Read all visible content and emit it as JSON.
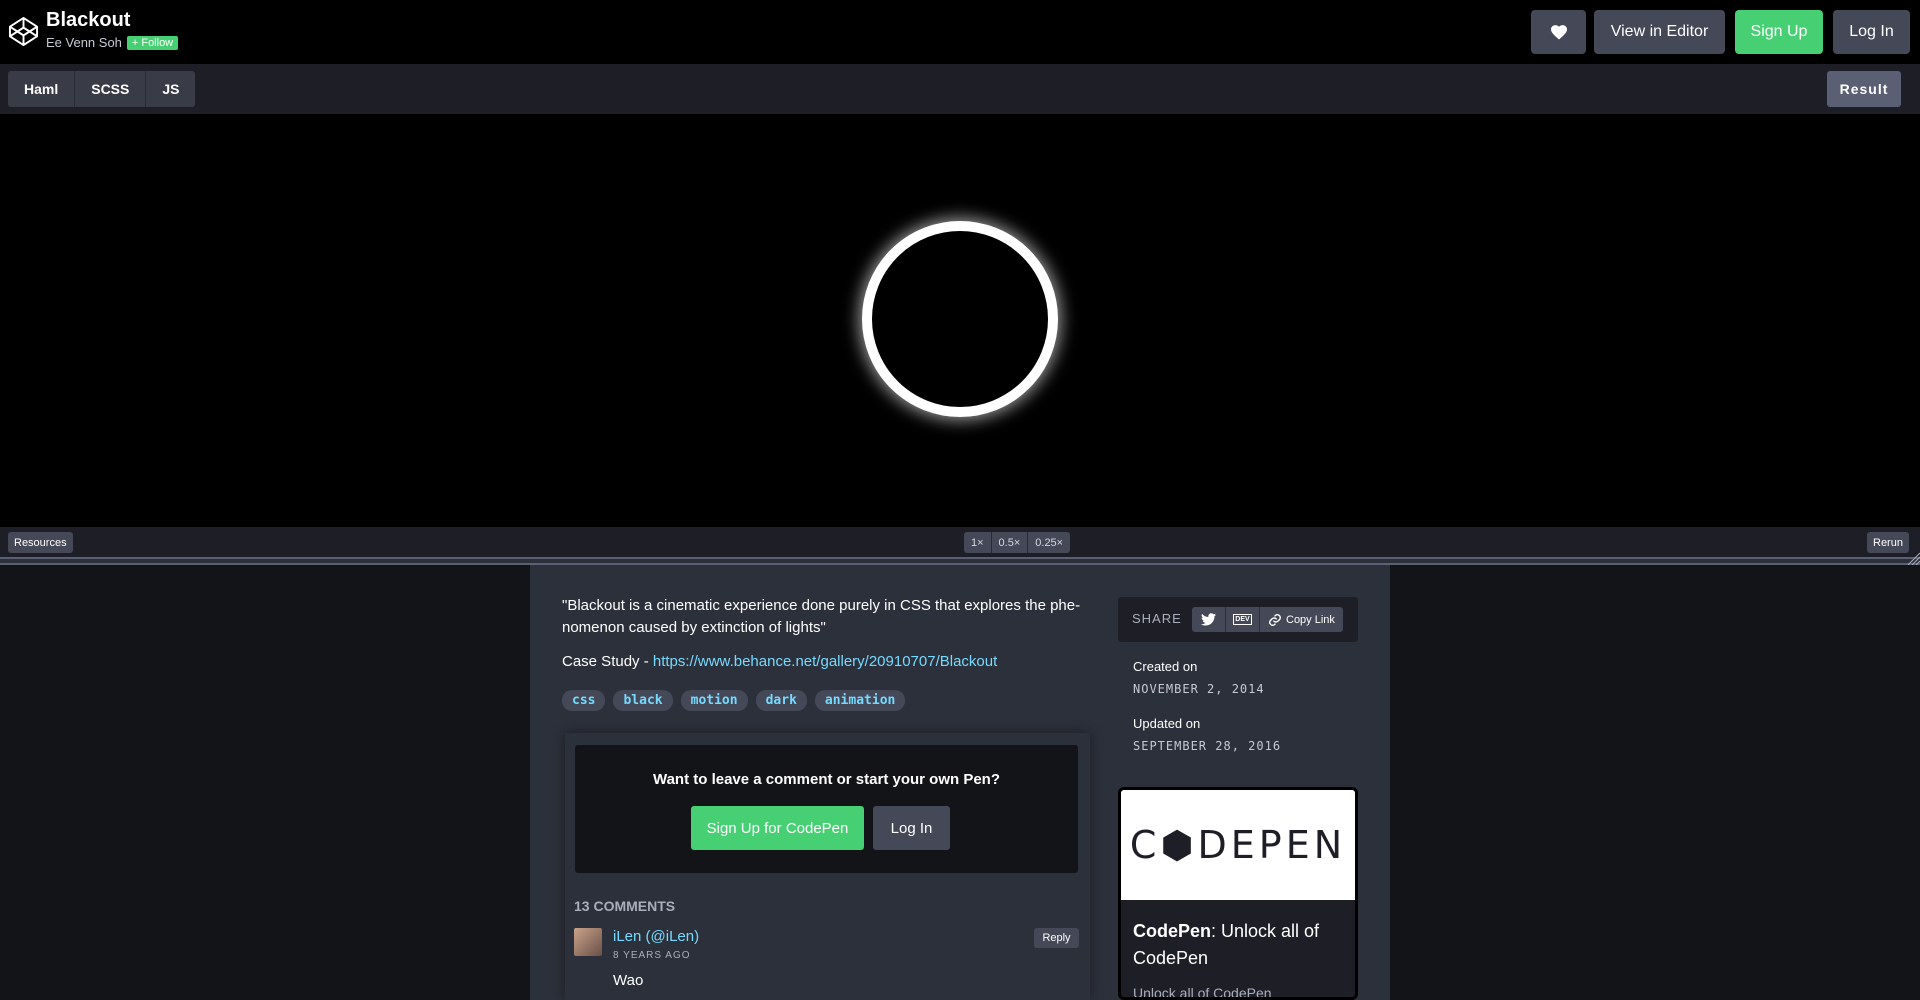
{
  "header": {
    "pen_title": "Blackout",
    "author": "Ee Venn Soh",
    "follow_label": "Follow",
    "view_in_editor": "View in Editor",
    "sign_up": "Sign Up",
    "log_in": "Log In"
  },
  "tabs": [
    "Haml",
    "SCSS",
    "JS"
  ],
  "result_tab": "Result",
  "preview_bar": {
    "resources": "Resources",
    "zoom_options": [
      "1×",
      "0.5×",
      "0.25×"
    ],
    "rerun": "Rerun"
  },
  "details": {
    "description": "\"Blackout is a cinematic experience done purely in CSS that explores the phe-nomenon caused by extinction of lights\"",
    "case_prefix": "Case Study - ",
    "case_link": "https://www.behance.net/gallery/20910707/Blackout",
    "tags": [
      "css",
      "black",
      "motion",
      "dark",
      "animation"
    ]
  },
  "comments": {
    "cta_text": "Want to leave a comment or start your own Pen?",
    "cta_signup": "Sign Up for CodePen",
    "cta_login": "Log In",
    "count_label": "13 COMMENTS",
    "first": {
      "name": "iLen (@iLen)",
      "time": "8 YEARS AGO",
      "reply": "Reply",
      "body": "Wao"
    }
  },
  "sidebar": {
    "share_label": "SHARE",
    "dev_label": "DEV",
    "copy_link": "Copy Link",
    "created_label": "Created on",
    "created_date": "NOVEMBER 2, 2014",
    "updated_label": "Updated on",
    "updated_date": "SEPTEMBER 28, 2016",
    "promo_logo": "C⬢DEPEN",
    "promo_title_bold": "CodePen",
    "promo_title_rest": ": Unlock all of CodePen",
    "promo_sub": "Unlock all of CodePen"
  },
  "colors": {
    "green": "#47cf73",
    "link": "#76daff",
    "button": "#444857",
    "panel": "#2c303a"
  }
}
